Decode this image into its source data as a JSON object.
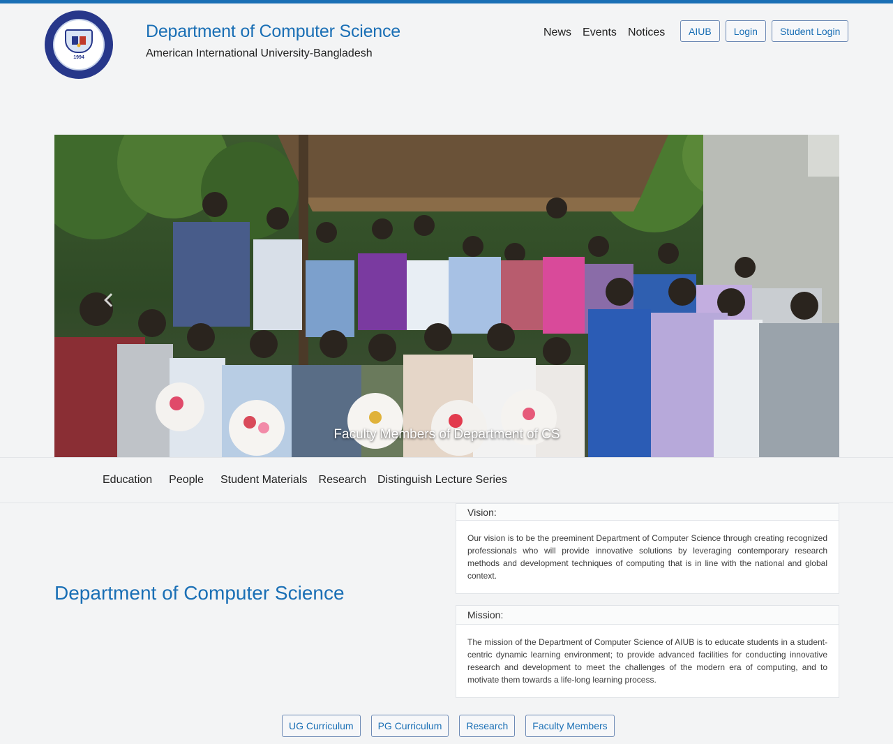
{
  "header": {
    "title": "Department of Computer Science",
    "subtitle": "American International University-Bangladesh",
    "logo": {
      "year": "1994"
    }
  },
  "topnav": [
    "News",
    "Events",
    "Notices"
  ],
  "auth": {
    "aiub": "AIUB",
    "login": "Login",
    "student_login": "Student Login"
  },
  "hero": {
    "caption": "Faculty Members of Department of CS"
  },
  "mainnav": [
    "Education",
    "People",
    "Student Materials",
    "Research",
    "Distinguish Lecture Series"
  ],
  "dept_heading": "Department of Computer Science",
  "vision": {
    "title": "Vision:",
    "text": "Our vision is to be the preeminent Department of Computer Science through creating recognized professionals who will provide innovative solutions by leveraging contemporary research methods and development techniques of computing that is in line with the national and global context."
  },
  "mission": {
    "title": "Mission:",
    "text": "The mission of the Department of Computer Science of AIUB is to educate students in a student-centric dynamic learning environment; to provide advanced facilities for conducting innovative research and development to meet the challenges of the modern era of computing, and to motivate them towards a life-long learning process."
  },
  "bottom_buttons": [
    "UG Curriculum",
    "PG Curriculum",
    "Research",
    "Faculty Members"
  ],
  "colors": {
    "accent": "#1a6fb5",
    "logo_blue": "#27378a",
    "background": "#f3f4f5"
  }
}
